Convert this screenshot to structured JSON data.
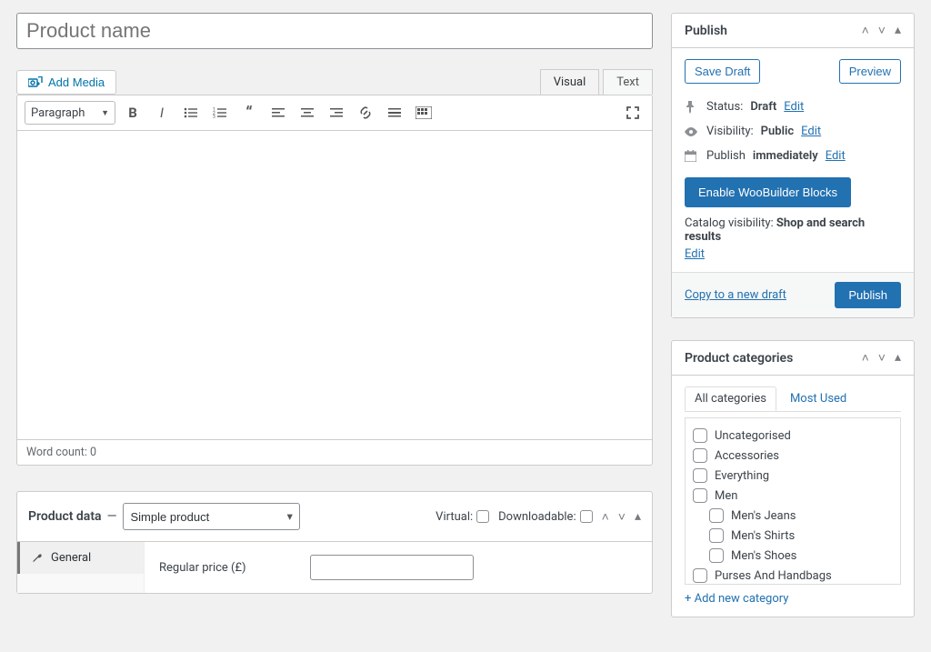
{
  "title": {
    "placeholder": "Product name",
    "value": ""
  },
  "editor": {
    "addMedia": "Add Media",
    "tabVisual": "Visual",
    "tabText": "Text",
    "formatSelector": "Paragraph",
    "wordCountLabel": "Word count: 0"
  },
  "productData": {
    "heading": "Product data",
    "dash": " — ",
    "typeOptions": [
      "Simple product"
    ],
    "typeSelected": "Simple product",
    "virtualLabel": "Virtual:",
    "downloadableLabel": "Downloadable:",
    "tabs": {
      "general": "General"
    },
    "fields": {
      "regularPriceLabel": "Regular price (£)",
      "regularPriceValue": ""
    }
  },
  "publish": {
    "heading": "Publish",
    "saveDraft": "Save Draft",
    "preview": "Preview",
    "statusLabel": "Status:",
    "statusValue": "Draft",
    "visibilityLabel": "Visibility:",
    "visibilityValue": "Public",
    "publishLabel": "Publish",
    "publishValue": "immediately",
    "editLink": "Edit",
    "wooBuilderBtn": "Enable WooBuilder Blocks",
    "catalogVisLabel": "Catalog visibility:",
    "catalogVisValue": "Shop and search results",
    "copyDraft": "Copy to a new draft",
    "publishBtn": "Publish"
  },
  "categories": {
    "heading": "Product categories",
    "tabAll": "All categories",
    "tabMost": "Most Used",
    "items": [
      {
        "label": "Uncategorised",
        "indent": false
      },
      {
        "label": "Accessories",
        "indent": false
      },
      {
        "label": "Everything",
        "indent": false
      },
      {
        "label": "Men",
        "indent": false
      },
      {
        "label": "Men's Jeans",
        "indent": true
      },
      {
        "label": "Men's Shirts",
        "indent": true
      },
      {
        "label": "Men's Shoes",
        "indent": true
      },
      {
        "label": "Purses And Handbags",
        "indent": false
      }
    ],
    "addNew": "+ Add new category"
  }
}
